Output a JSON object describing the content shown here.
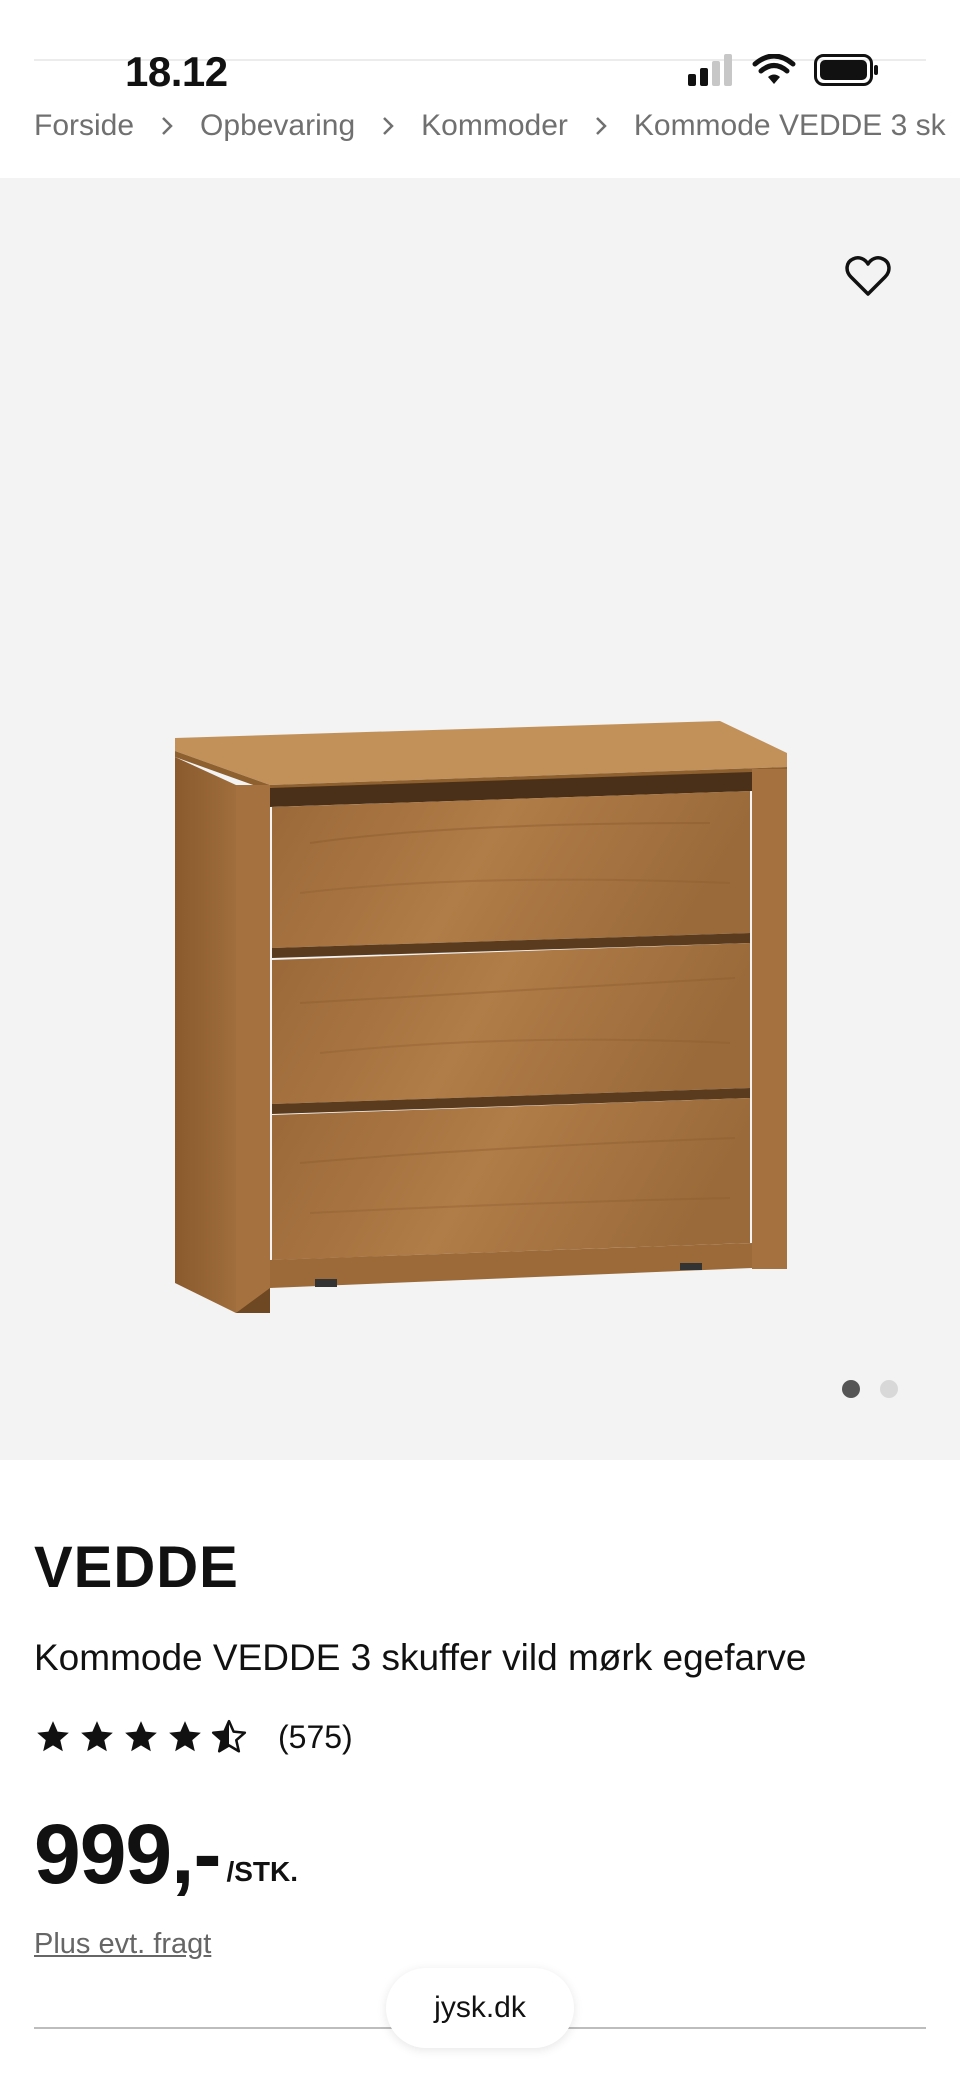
{
  "status_bar": {
    "time": "18.12",
    "signal_icon": "signal-bars-icon",
    "wifi_icon": "wifi-icon",
    "battery_icon": "battery-icon"
  },
  "breadcrumb": {
    "items": [
      "Forside",
      "Opbevaring",
      "Kommoder",
      "Kommode VEDDE 3 sk"
    ],
    "separator_icon": "chevron-right-icon"
  },
  "gallery": {
    "wishlist_icon": "heart-outline-icon",
    "image_alt": "Kommode med 3 skuffer i mørk egefarve",
    "slide_count": 2,
    "active_slide": 1
  },
  "product": {
    "brand": "VEDDE",
    "name": "Kommode VEDDE 3 skuffer vild mørk egefarve",
    "rating": 4.5,
    "rating_max": 5,
    "review_count": "(575)",
    "price": "999,-",
    "unit": "/STK.",
    "shipping_link": "Plus evt. fragt"
  },
  "browser": {
    "url": "jysk.dk"
  },
  "colors": {
    "gallery_bg": "#f3f3f3",
    "text": "#111111",
    "muted": "#707070",
    "wood": "#a0703e"
  }
}
